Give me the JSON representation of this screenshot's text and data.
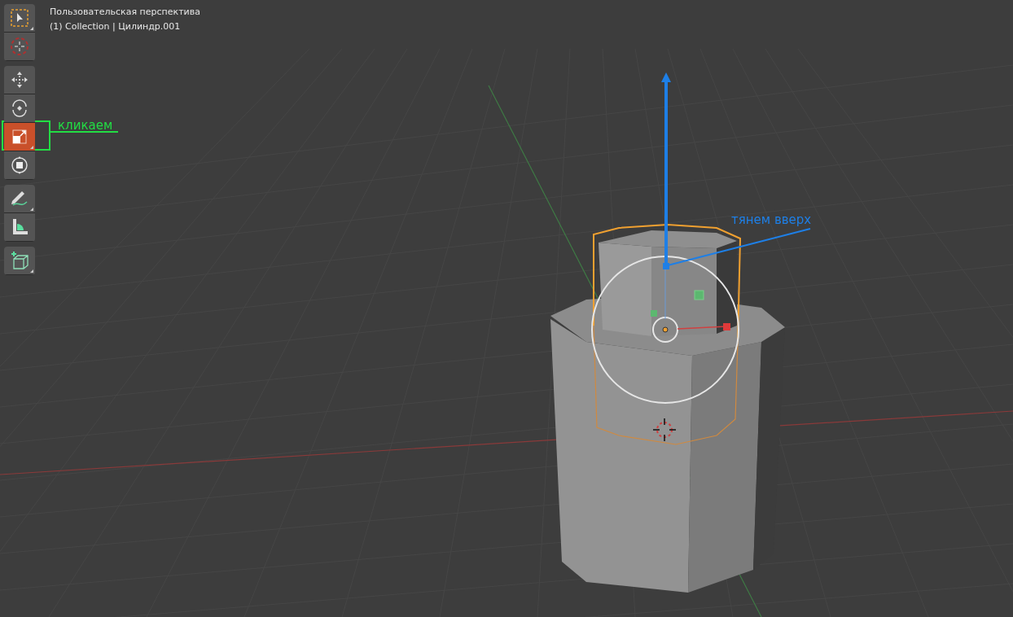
{
  "viewport": {
    "title": "Пользовательская перспектива",
    "collection": "(1) Collection | Цилиндр.001"
  },
  "toolbar": [
    {
      "tools": [
        {
          "kind": "select",
          "selected": false
        },
        {
          "kind": "cursor",
          "selected": false
        }
      ]
    },
    {
      "tools": [
        {
          "kind": "move",
          "selected": false
        },
        {
          "kind": "rotate",
          "selected": false
        },
        {
          "kind": "scale",
          "selected": true
        },
        {
          "kind": "transform",
          "selected": false
        }
      ]
    },
    {
      "tools": [
        {
          "kind": "annotate",
          "selected": false
        },
        {
          "kind": "measure",
          "selected": false
        }
      ]
    },
    {
      "tools": [
        {
          "kind": "add-cube",
          "selected": false
        }
      ]
    }
  ],
  "annotations": [
    {
      "kind": "tool",
      "text": "кликаем",
      "color": "#22dd44"
    },
    {
      "kind": "gizmo",
      "text": "тянем вверх",
      "color": "#1e7fe6"
    }
  ]
}
